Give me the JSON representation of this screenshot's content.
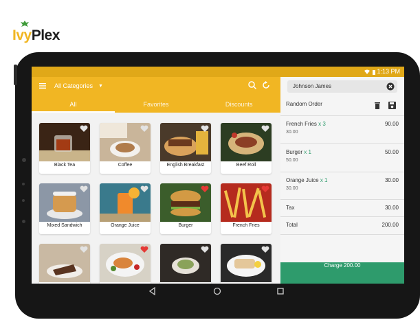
{
  "brand": {
    "prefix": "Ivy",
    "suffix": "Plex"
  },
  "status_bar": {
    "time": "1:13 PM"
  },
  "header": {
    "category_select": "All Categories",
    "tabs": [
      {
        "label": "All",
        "active": true
      },
      {
        "label": "Favorites",
        "active": false
      },
      {
        "label": "Discounts",
        "active": false
      }
    ]
  },
  "products": [
    {
      "name": "Black Tea",
      "favorite": false
    },
    {
      "name": "Coffee",
      "favorite": false
    },
    {
      "name": "English Breakfast",
      "favorite": false
    },
    {
      "name": "Beef Roll",
      "favorite": false
    },
    {
      "name": "Mixed Sandwich",
      "favorite": false
    },
    {
      "name": "Orange Juice",
      "favorite": false
    },
    {
      "name": "Burger",
      "favorite": true
    },
    {
      "name": "French Fries",
      "favorite": true
    },
    {
      "name": "",
      "favorite": false
    },
    {
      "name": "",
      "favorite": true
    },
    {
      "name": "",
      "favorite": false
    },
    {
      "name": "",
      "favorite": false
    }
  ],
  "order": {
    "customer": "Johnson James",
    "title": "Random Order",
    "items": [
      {
        "name": "French Fries",
        "qty": "x 3",
        "unit_price": "30.00",
        "price": "90.00"
      },
      {
        "name": "Burger",
        "qty": "x 1",
        "unit_price": "50.00",
        "price": "50.00"
      },
      {
        "name": "Orange Juice",
        "qty": "x 1",
        "unit_price": "30.00",
        "price": "30.00"
      }
    ],
    "tax_label": "Tax",
    "tax_value": "30.00",
    "total_label": "Total",
    "total_value": "200.00",
    "charge_label": "Charge 200.00"
  },
  "colors": {
    "header_yellow": "#f1b623",
    "accent_green": "#2e9b6c",
    "heart_red": "#e53935"
  },
  "icons": [
    "ivy-leaf-icon",
    "menu-icon",
    "chevron-down-icon",
    "search-icon",
    "refresh-icon",
    "close-icon",
    "trash-icon",
    "save-icon",
    "heart-icon",
    "back-icon",
    "home-icon",
    "recents-icon",
    "wifi-icon",
    "battery-icon"
  ]
}
